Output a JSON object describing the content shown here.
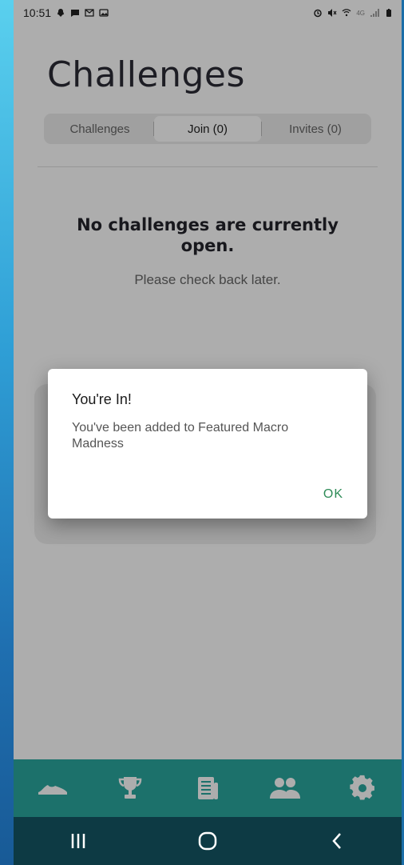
{
  "status_bar": {
    "time": "10:51",
    "network": "4G"
  },
  "page": {
    "title": "Challenges"
  },
  "tabs": [
    {
      "label": "Challenges",
      "active": false
    },
    {
      "label": "Join (0)",
      "active": true
    },
    {
      "label": "Invites (0)",
      "active": false
    }
  ],
  "empty_state": {
    "title": "No challenges are currently open.",
    "subtitle": "Please check back later."
  },
  "dialog": {
    "title": "You're In!",
    "message": "You've been added to Featured Macro Madness",
    "ok_label": "OK"
  },
  "bottom_nav": [
    {
      "icon": "shoe-icon"
    },
    {
      "icon": "trophy-icon"
    },
    {
      "icon": "news-icon"
    },
    {
      "icon": "people-icon"
    },
    {
      "icon": "gear-icon"
    }
  ],
  "system_nav": [
    {
      "icon": "recent-apps-icon"
    },
    {
      "icon": "home-icon"
    },
    {
      "icon": "back-icon"
    }
  ],
  "colors": {
    "accent": "#2aa79e",
    "system_bar": "#0d3a44",
    "ok": "#2e8b57"
  }
}
